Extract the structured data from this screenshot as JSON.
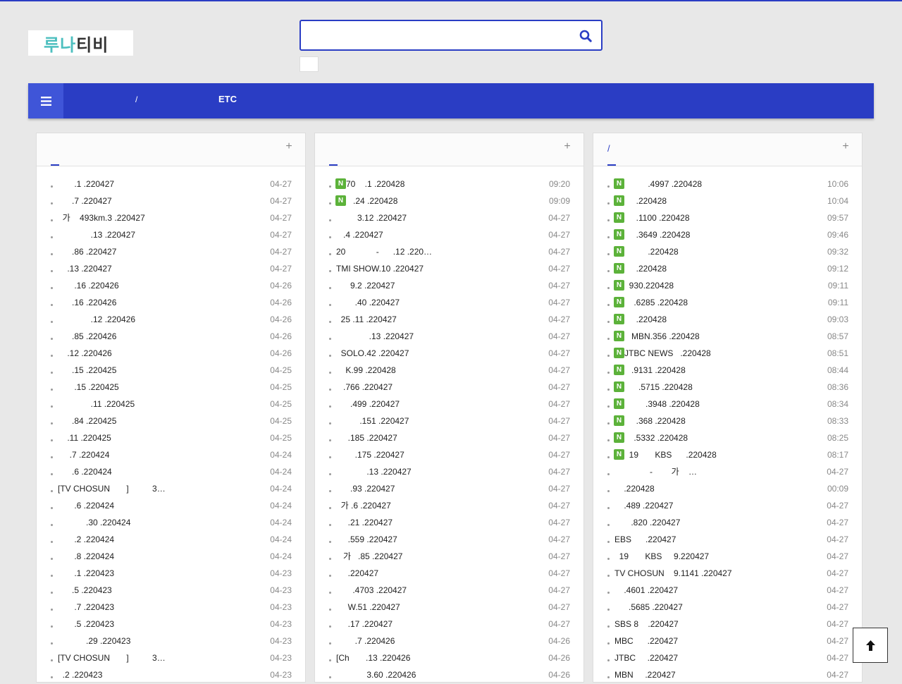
{
  "logo": {
    "part1": "루나",
    "part2": "티비"
  },
  "search": {
    "value": "",
    "placeholder": ""
  },
  "nav": {
    "items": [
      "/",
      "ETC"
    ]
  },
  "panels": [
    {
      "tab": "",
      "items": [
        {
          "title": "       .1 .220427",
          "date": "04-27",
          "new": false
        },
        {
          "title": "      .7 .220427",
          "date": "04-27",
          "new": false
        },
        {
          "title": "  가    493km.3 .220427",
          "date": "04-27",
          "new": false
        },
        {
          "title": "              .13 .220427",
          "date": "04-27",
          "new": false
        },
        {
          "title": "      .86 .220427",
          "date": "04-27",
          "new": false
        },
        {
          "title": "    .13 .220427",
          "date": "04-27",
          "new": false
        },
        {
          "title": "       .16 .220426",
          "date": "04-26",
          "new": false
        },
        {
          "title": "      .16 .220426",
          "date": "04-26",
          "new": false
        },
        {
          "title": "              .12 .220426",
          "date": "04-26",
          "new": false
        },
        {
          "title": "      .85 .220426",
          "date": "04-26",
          "new": false
        },
        {
          "title": "    .12 .220426",
          "date": "04-26",
          "new": false
        },
        {
          "title": "      .15 .220425",
          "date": "04-25",
          "new": false
        },
        {
          "title": "       .15 .220425",
          "date": "04-25",
          "new": false
        },
        {
          "title": "              .11 .220425",
          "date": "04-25",
          "new": false
        },
        {
          "title": "      .84 .220425",
          "date": "04-25",
          "new": false
        },
        {
          "title": "    .11 .220425",
          "date": "04-25",
          "new": false
        },
        {
          "title": "     .7 .220424",
          "date": "04-24",
          "new": false
        },
        {
          "title": "      .6 .220424",
          "date": "04-24",
          "new": false
        },
        {
          "title": "[TV CHOSUN       ]          3…",
          "date": "04-24",
          "new": false
        },
        {
          "title": "       .6 .220424",
          "date": "04-24",
          "new": false
        },
        {
          "title": "            .30 .220424",
          "date": "04-24",
          "new": false
        },
        {
          "title": "       .2 .220424",
          "date": "04-24",
          "new": false
        },
        {
          "title": "       .8 .220424",
          "date": "04-24",
          "new": false
        },
        {
          "title": "       .1 .220423",
          "date": "04-23",
          "new": false
        },
        {
          "title": "      .5 .220423",
          "date": "04-23",
          "new": false
        },
        {
          "title": "       .7 .220423",
          "date": "04-23",
          "new": false
        },
        {
          "title": "       .5 .220423",
          "date": "04-23",
          "new": false
        },
        {
          "title": "            .29 .220423",
          "date": "04-23",
          "new": false
        },
        {
          "title": "[TV CHOSUN       ]          3…",
          "date": "04-23",
          "new": false
        },
        {
          "title": "  .2 .220423",
          "date": "04-23",
          "new": false
        }
      ]
    },
    {
      "tab": "",
      "items": [
        {
          "title": "70    .1 .220428",
          "date": "09:20",
          "new": true
        },
        {
          "title": "   .24 .220428",
          "date": "09:09",
          "new": true
        },
        {
          "title": "         3.12 .220427",
          "date": "04-27",
          "new": false
        },
        {
          "title": "   .4 .220427",
          "date": "04-27",
          "new": false
        },
        {
          "title": "20             -      .12 .220…",
          "date": "04-27",
          "new": false
        },
        {
          "title": "TMI SHOW.10 .220427",
          "date": "04-27",
          "new": false
        },
        {
          "title": "      9.2 .220427",
          "date": "04-27",
          "new": false
        },
        {
          "title": "        .40 .220427",
          "date": "04-27",
          "new": false
        },
        {
          "title": "  25 .11 .220427",
          "date": "04-27",
          "new": false
        },
        {
          "title": "              .13 .220427",
          "date": "04-27",
          "new": false
        },
        {
          "title": "  SOLO.42 .220427",
          "date": "04-27",
          "new": false
        },
        {
          "title": "    K.99 .220428",
          "date": "04-27",
          "new": false
        },
        {
          "title": "   .766 .220427",
          "date": "04-27",
          "new": false
        },
        {
          "title": "      .499 .220427",
          "date": "04-27",
          "new": false
        },
        {
          "title": "          .151 .220427",
          "date": "04-27",
          "new": false
        },
        {
          "title": "     .185 .220427",
          "date": "04-27",
          "new": false
        },
        {
          "title": "        .175 .220427",
          "date": "04-27",
          "new": false
        },
        {
          "title": "             .13 .220427",
          "date": "04-27",
          "new": false
        },
        {
          "title": "      .93 .220427",
          "date": "04-27",
          "new": false
        },
        {
          "title": "  가 .6 .220427",
          "date": "04-27",
          "new": false
        },
        {
          "title": "     .21 .220427",
          "date": "04-27",
          "new": false
        },
        {
          "title": "     .559 .220427",
          "date": "04-27",
          "new": false
        },
        {
          "title": "   가   .85 .220427",
          "date": "04-27",
          "new": false
        },
        {
          "title": "     .220427",
          "date": "04-27",
          "new": false
        },
        {
          "title": "       .4703 .220427",
          "date": "04-27",
          "new": false
        },
        {
          "title": "     W.51 .220427",
          "date": "04-27",
          "new": false
        },
        {
          "title": "     .17 .220427",
          "date": "04-27",
          "new": false
        },
        {
          "title": "        .7 .220426",
          "date": "04-26",
          "new": false
        },
        {
          "title": "[Ch       .13 .220426",
          "date": "04-26",
          "new": false
        },
        {
          "title": "             3.60 .220426",
          "date": "04-26",
          "new": false
        }
      ]
    },
    {
      "tab": "/",
      "items": [
        {
          "title": "          .4997 .220428",
          "date": "10:06",
          "new": true
        },
        {
          "title": "     .220428",
          "date": "10:04",
          "new": true
        },
        {
          "title": "     .1100 .220428",
          "date": "09:57",
          "new": true
        },
        {
          "title": "     .3649 .220428",
          "date": "09:46",
          "new": true
        },
        {
          "title": "          .220428",
          "date": "09:32",
          "new": true
        },
        {
          "title": "     .220428",
          "date": "09:12",
          "new": true
        },
        {
          "title": "  930.220428",
          "date": "09:11",
          "new": true
        },
        {
          "title": "    .6285 .220428",
          "date": "09:11",
          "new": true
        },
        {
          "title": "     .220428",
          "date": "09:03",
          "new": true
        },
        {
          "title": "   MBN.356 .220428",
          "date": "08:57",
          "new": true
        },
        {
          "title": "JTBC NEWS   .220428",
          "date": "08:51",
          "new": true
        },
        {
          "title": "   .9131 .220428",
          "date": "08:44",
          "new": true
        },
        {
          "title": "      .5715 .220428",
          "date": "08:36",
          "new": true
        },
        {
          "title": "         .3948 .220428",
          "date": "08:34",
          "new": true
        },
        {
          "title": "     .368 .220428",
          "date": "08:33",
          "new": true
        },
        {
          "title": "    .5332 .220428",
          "date": "08:25",
          "new": true
        },
        {
          "title": "  19       KBS      .220428",
          "date": "08:17",
          "new": true
        },
        {
          "title": "               -        가    …",
          "date": "04-27",
          "new": false
        },
        {
          "title": "    .220428",
          "date": "00:09",
          "new": false
        },
        {
          "title": "    .489 .220427",
          "date": "04-27",
          "new": false
        },
        {
          "title": "       .820 .220427",
          "date": "04-27",
          "new": false
        },
        {
          "title": "EBS      .220427",
          "date": "04-27",
          "new": false
        },
        {
          "title": "  19       KBS     9.220427",
          "date": "04-27",
          "new": false
        },
        {
          "title": "TV CHOSUN    9.1141 .220427",
          "date": "04-27",
          "new": false
        },
        {
          "title": "    .4601 .220427",
          "date": "04-27",
          "new": false
        },
        {
          "title": "      .5685 .220427",
          "date": "04-27",
          "new": false
        },
        {
          "title": "SBS 8    .220427",
          "date": "04-27",
          "new": false
        },
        {
          "title": "MBC      .220427",
          "date": "04-27",
          "new": false
        },
        {
          "title": "JTBC     .220427",
          "date": "04-27",
          "new": false
        },
        {
          "title": "MBN     .220427",
          "date": "04-27",
          "new": false
        }
      ]
    }
  ],
  "badge_label": "N",
  "colors": {
    "accent": "#2a3dc4",
    "menu_button": "#3f55d8",
    "new_badge": "#5cb23a",
    "background": "#e8e8e8"
  },
  "icons": {
    "search": "search-icon",
    "menu": "hamburger-menu-icon",
    "plus": "plus-icon",
    "to_top": "arrow-up-icon"
  }
}
